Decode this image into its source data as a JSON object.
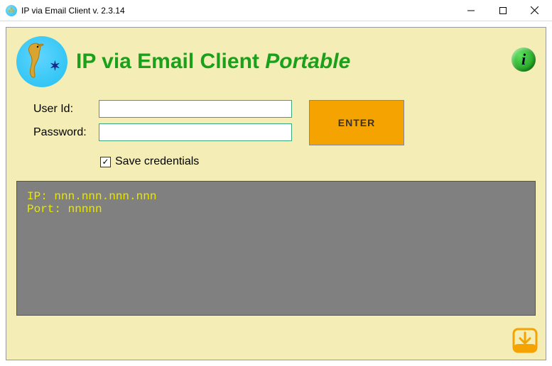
{
  "window": {
    "title": "IP via Email Client v. 2.3.14"
  },
  "header": {
    "app_name": "IP via Email Client",
    "variant": "Portable"
  },
  "form": {
    "user_id_label": "User Id:",
    "user_id_value": "",
    "password_label": "Password:",
    "password_value": "",
    "enter_label": "ENTER",
    "save_credentials_label": "Save credentials",
    "save_credentials_checked": true
  },
  "console": {
    "line1": "IP: nnn.nnn.nnn.nnn",
    "line2": "Port: nnnnn"
  },
  "colors": {
    "panel_bg": "#f4eeb6",
    "accent_green": "#1aa01a",
    "button_bg": "#f5a300",
    "console_bg": "#808080",
    "console_fg": "#e8e800"
  }
}
